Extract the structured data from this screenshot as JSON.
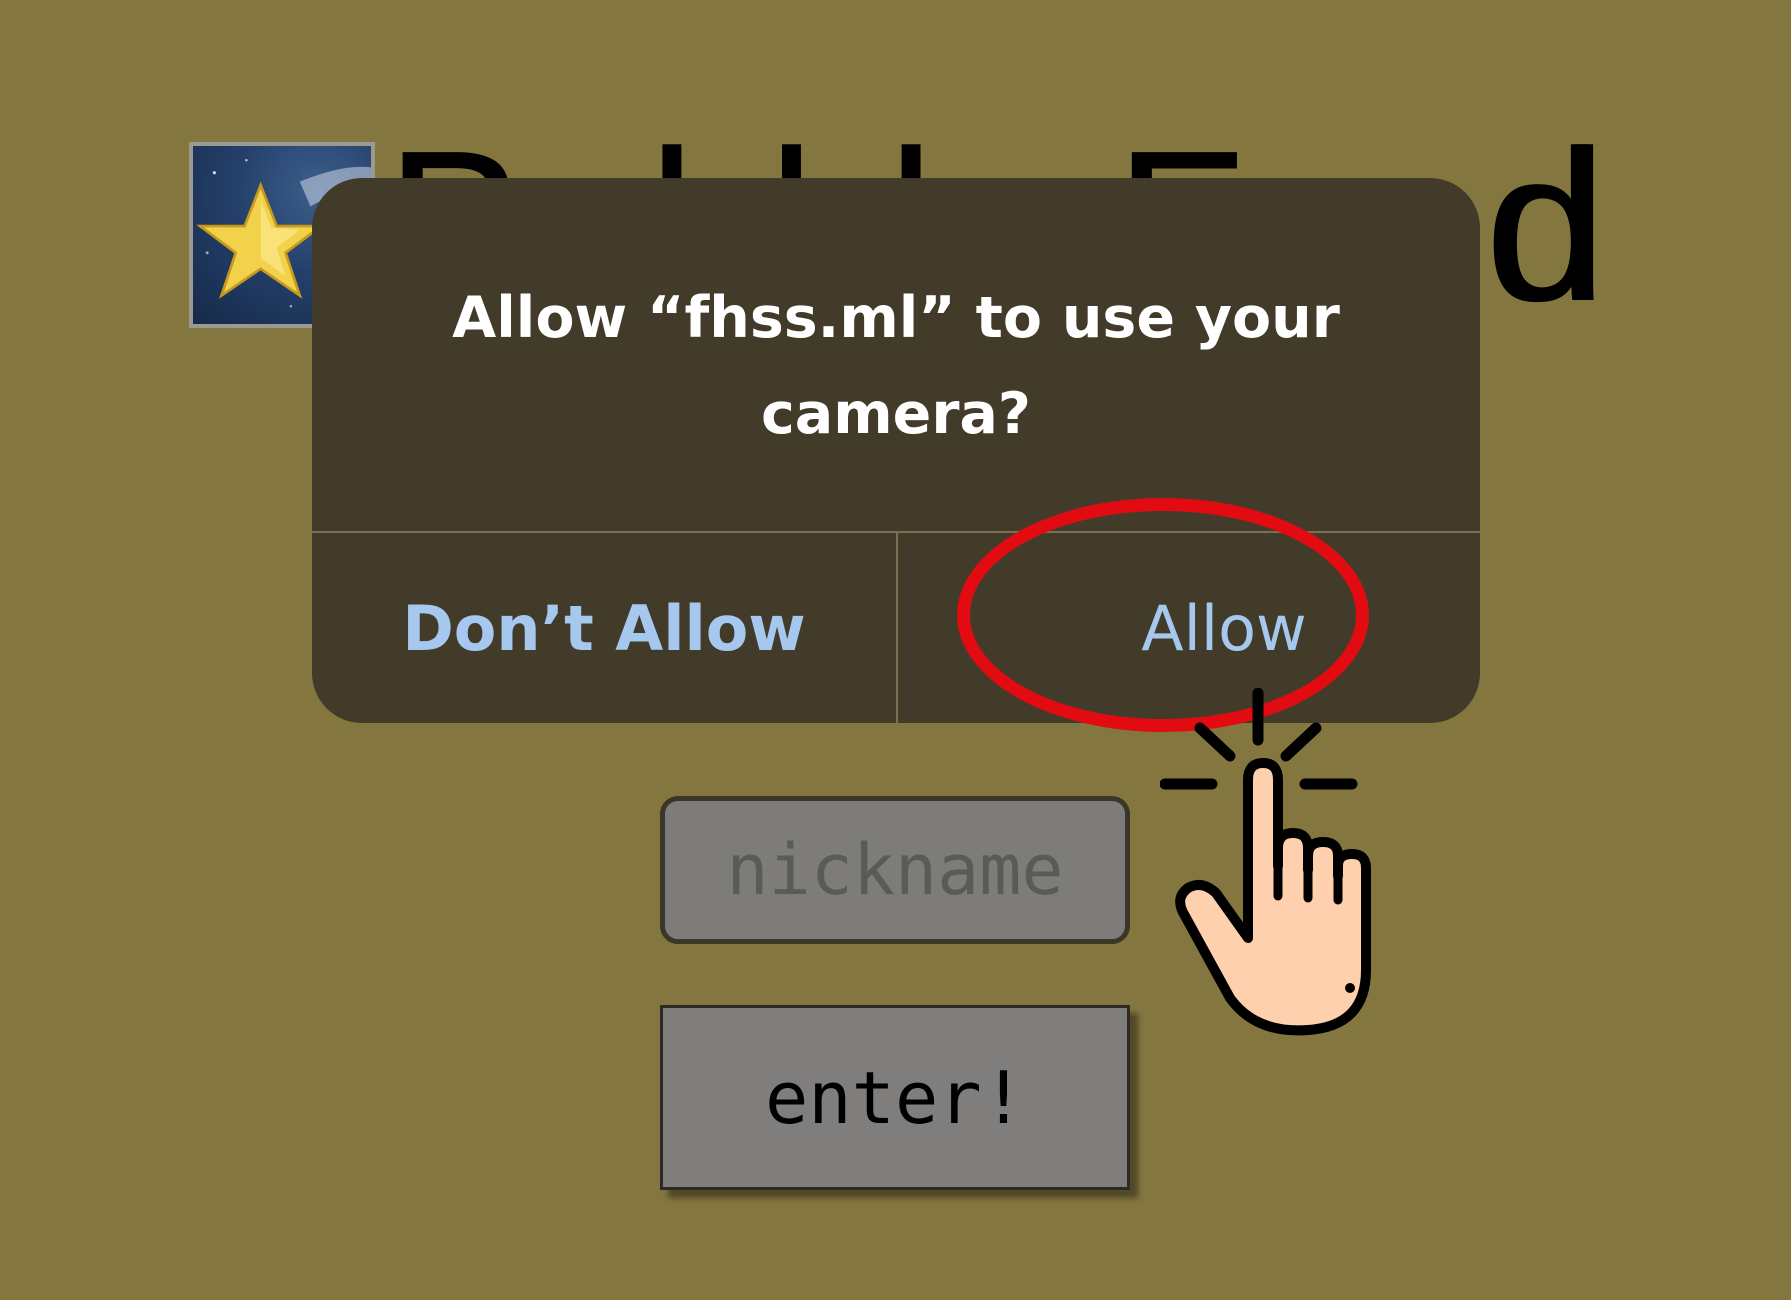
{
  "page": {
    "title": "Bubble Fund",
    "title_visible_tail": "d",
    "background_color": "#84763f"
  },
  "logo": {
    "icon": "shooting-star-icon"
  },
  "alert": {
    "message": "Allow “fhss.ml” to use your camera?",
    "deny_label": "Don’t Allow",
    "allow_label": "Allow",
    "background_color": "#433b2a",
    "button_color": "#a6c8ef"
  },
  "form": {
    "nickname_placeholder": "nickname",
    "nickname_value": "",
    "enter_label": "enter!"
  },
  "annotation": {
    "highlight_color": "#e10b11",
    "pointer_icon": "tap-hand-icon"
  }
}
